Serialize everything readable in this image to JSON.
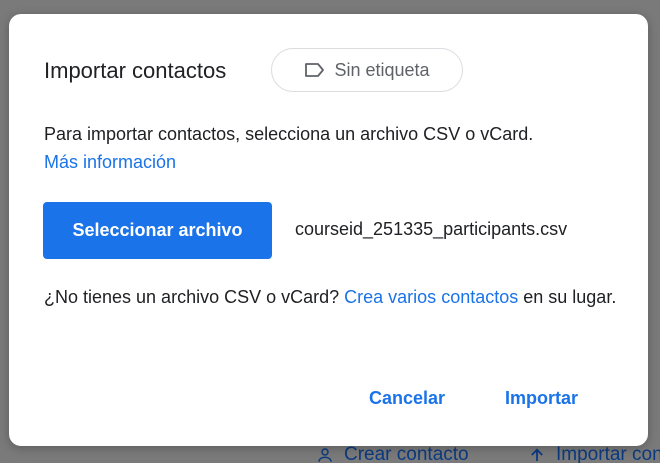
{
  "dialog": {
    "title": "Importar contactos",
    "label_chip": {
      "text": "Sin etiqueta",
      "icon": "label-icon"
    },
    "description": "Para importar contactos, selecciona un archivo CSV o vCard.",
    "more_info_link": "Más información",
    "select_file_button": "Seleccionar archivo",
    "selected_file": "courseid_251335_participants.csv",
    "alternative_prefix": "¿No tienes un archivo CSV o vCard?",
    "alternative_link": "Crea varios contactos",
    "alternative_suffix": "en su lugar.",
    "cancel_button": "Cancelar",
    "import_button": "Importar"
  },
  "background": {
    "create_contact": "Crear contacto",
    "import_contacts": "Importar contactos"
  },
  "colors": {
    "accent": "#1a73e8",
    "overlay": "#7a7a7a",
    "text": "#202124",
    "muted": "#5f6368"
  }
}
